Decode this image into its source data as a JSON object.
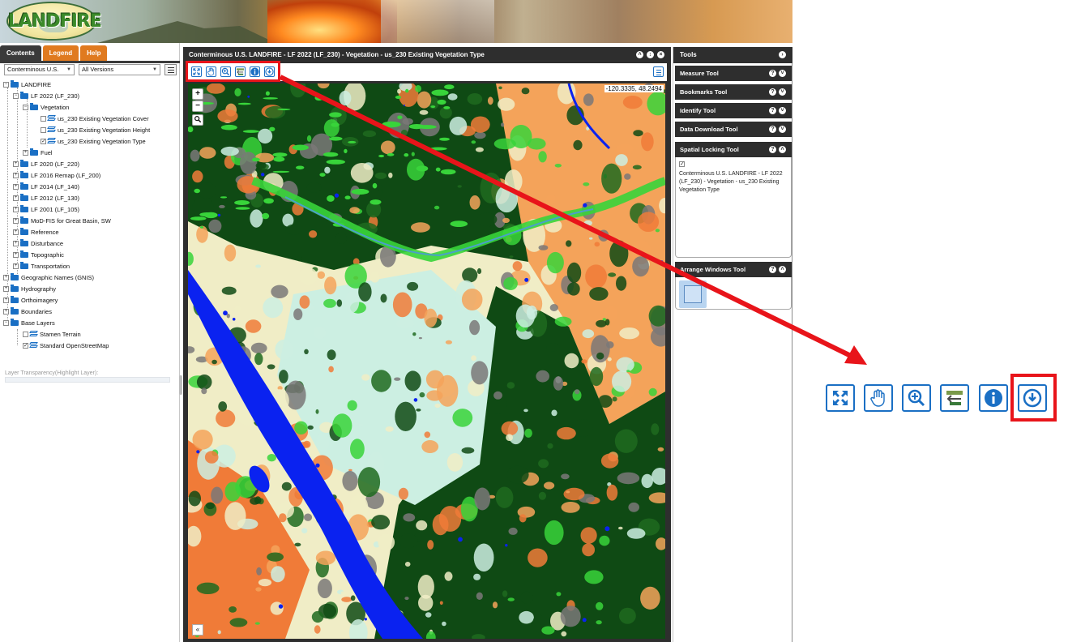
{
  "window": {
    "logo_text": "LANDFIRE"
  },
  "left_panel": {
    "tabs": [
      {
        "label": "Contents"
      },
      {
        "label": "Legend"
      },
      {
        "label": "Help"
      }
    ],
    "region_select": "Conterminous U.S.",
    "version_select": "All Versions",
    "tree": {
      "landfire": "LANDFIRE",
      "lf2022": "LF 2022 (LF_230)",
      "vegetation": "Vegetation",
      "evc": "us_230 Existing Vegetation Cover",
      "evh": "us_230 Existing Vegetation Height",
      "evt": "us_230 Existing Vegetation Type",
      "fuel": "Fuel",
      "lf2020": "LF 2020 (LF_220)",
      "lf2016": "LF 2016 Remap (LF_200)",
      "lf2014": "LF 2014 (LF_140)",
      "lf2012": "LF 2012 (LF_130)",
      "lf2001": "LF 2001 (LF_105)",
      "modfis": "MoD-FIS for Great Basin, SW",
      "reference": "Reference",
      "disturbance": "Disturbance",
      "topographic": "Topographic",
      "transportation": "Transportation",
      "gnis": "Geographic Names (GNIS)",
      "hydrography": "Hydrography",
      "orthoimagery": "Orthoimagery",
      "boundaries": "Boundaries",
      "base_layers": "Base Layers",
      "stamen": "Stamen Terrain",
      "osm": "Standard OpenStreetMap"
    },
    "transparency_label": "Layer Transparency(Highlight Layer):"
  },
  "map_window": {
    "title": "Conterminous U.S. LANDFIRE - LF 2022 (LF_230) - Vegetation - us_230 Existing Vegetation Type",
    "coordinates": "-120.3335, 48.2494",
    "zoom_in": "+",
    "zoom_out": "−",
    "collapse": "«",
    "palette": {
      "conifer": "#0f4a14",
      "conifer_mid": "#1f6a1e",
      "grass": "#38d43a",
      "shrub_pale": "#ccefe2",
      "shrub_cream": "#f0edc6",
      "barren": "#7a7878",
      "ag_orange": "#f4a35a",
      "dev_orange": "#f07b38",
      "water": "#0a22f0"
    }
  },
  "tools_panel": {
    "title": "Tools",
    "tools": [
      {
        "label": "Measure Tool"
      },
      {
        "label": "Bookmarks Tool"
      },
      {
        "label": "Identify Tool"
      },
      {
        "label": "Data Download Tool"
      },
      {
        "label": "Spatial Locking Tool"
      },
      {
        "label": "Arrange Windows Tool"
      }
    ],
    "spatial_lock_text": "Conterminous U.S. LANDFIRE - LF 2022 (LF_230) - Vegetation - us_230 Existing Vegetation Type"
  },
  "toolbar_icons": [
    "full-extent-icon",
    "pan-hand-icon",
    "zoom-in-icon",
    "previous-extent-icon",
    "info-icon",
    "download-icon"
  ],
  "annotation": {
    "highlight_color": "#e8141a",
    "button_color": "#1a6fc4"
  }
}
